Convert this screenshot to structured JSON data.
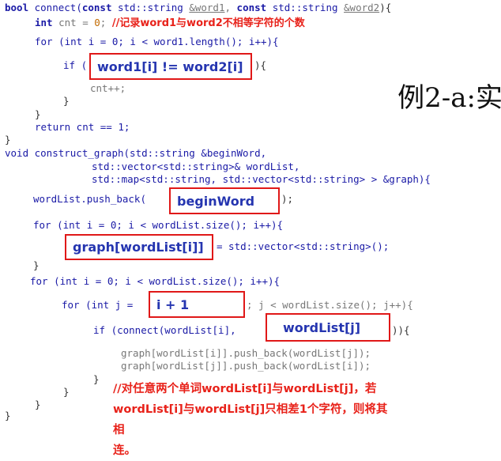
{
  "slide_title": "例2-a:实",
  "lines": {
    "l1_a": "bool",
    "l1_b": " connect(",
    "l1_c": "const",
    "l1_d": " std::string ",
    "l1_e": "&word1",
    "l1_f": ", ",
    "l1_g": "const",
    "l1_h": " std::string ",
    "l1_i": "&word2",
    "l1_j": "){",
    "l2_a": "int",
    "l2_b": " cnt = ",
    "l2_c": "0",
    "l2_d": "; ",
    "l2_comment": "//记录word1与word2不相等字符的个数",
    "l3": "for (int i = 0; i < word1.length(); i++){",
    "l4_a": "if (",
    "l4_b": "){",
    "l5": "cnt++;",
    "l6": "}",
    "l7": "}",
    "l8": "return cnt == 1;",
    "l9": "}",
    "l10": "void construct_graph(std::string &beginWord,",
    "l11": "std::vector<std::string>& wordList,",
    "l12": "std::map<std::string, std::vector<std::string> > &graph){",
    "l13_a": "wordList.push_back(",
    "l13_b": ");",
    "l14": "for (int i = 0; i < wordList.size(); i++){",
    "l15": "= std::vector<std::string>();",
    "l16": "}",
    "l17": "for (int i = 0; i < wordList.size(); i++){",
    "l18_a": "for (int j =",
    "l18_b": "; j < wordList.size(); j++){",
    "l19_a": "if (connect(wordList[i],",
    "l19_b": ")){",
    "l20": "graph[wordList[i]].push_back(wordList[j]);",
    "l21": "graph[wordList[j]].push_back(wordList[i]);",
    "l22": "}",
    "l23": "}",
    "l24": "}",
    "l25": "}"
  },
  "boxes": {
    "condition": "word1[i] != word2[i]",
    "begin_word": "beginWord",
    "graph_init": "graph[wordList[i]]",
    "j_init": "i + 1",
    "second_arg": "wordList[j]"
  },
  "note": {
    "line1": "//对任意两个单词wordList[i]与wordList[j]，若",
    "line2": "wordList[i]与wordList[j]只相差1个字符，则将其相",
    "line3": "连。"
  }
}
